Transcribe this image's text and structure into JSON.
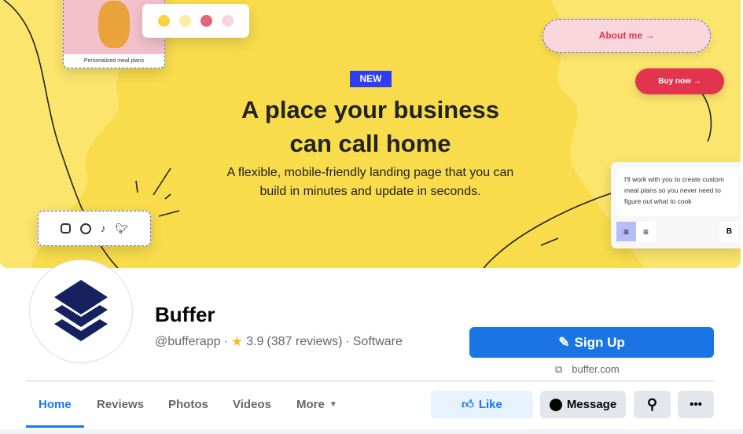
{
  "cover": {
    "card_caption": "Personalized meal plans",
    "swatch_colors": [
      "#f6d53f",
      "#fbef9f",
      "#e4647a",
      "#f9d3da"
    ],
    "badge": "NEW",
    "headline_line1": "A place your business",
    "headline_line2": "can call home",
    "subtitle_line1": "A flexible, mobile-friendly landing page that you can",
    "subtitle_line2": "build in minutes and update in seconds.",
    "about_button": "About me →",
    "buy_button": "Buy now →",
    "editor_text": "I'll work with you to create custom meal plans so you never need to figure out what to cook",
    "bold_button": "B",
    "social_icons": [
      "instagram-icon",
      "youtube-icon",
      "tiktok-icon",
      "twitter-icon"
    ]
  },
  "profile": {
    "name": "Buffer",
    "handle": "@bufferapp",
    "rating": "3.9",
    "reviews": "(387 reviews)",
    "category": "Software",
    "sep": "·"
  },
  "actions": {
    "signup": "Sign Up",
    "website": "buffer.com",
    "like": "Like",
    "message": "Message"
  },
  "tabs": [
    "Home",
    "Reviews",
    "Photos",
    "Videos",
    "More"
  ],
  "colors": {
    "primary": "#1b74e4",
    "cover": "#f8dc4b",
    "logo": "#16215f"
  }
}
